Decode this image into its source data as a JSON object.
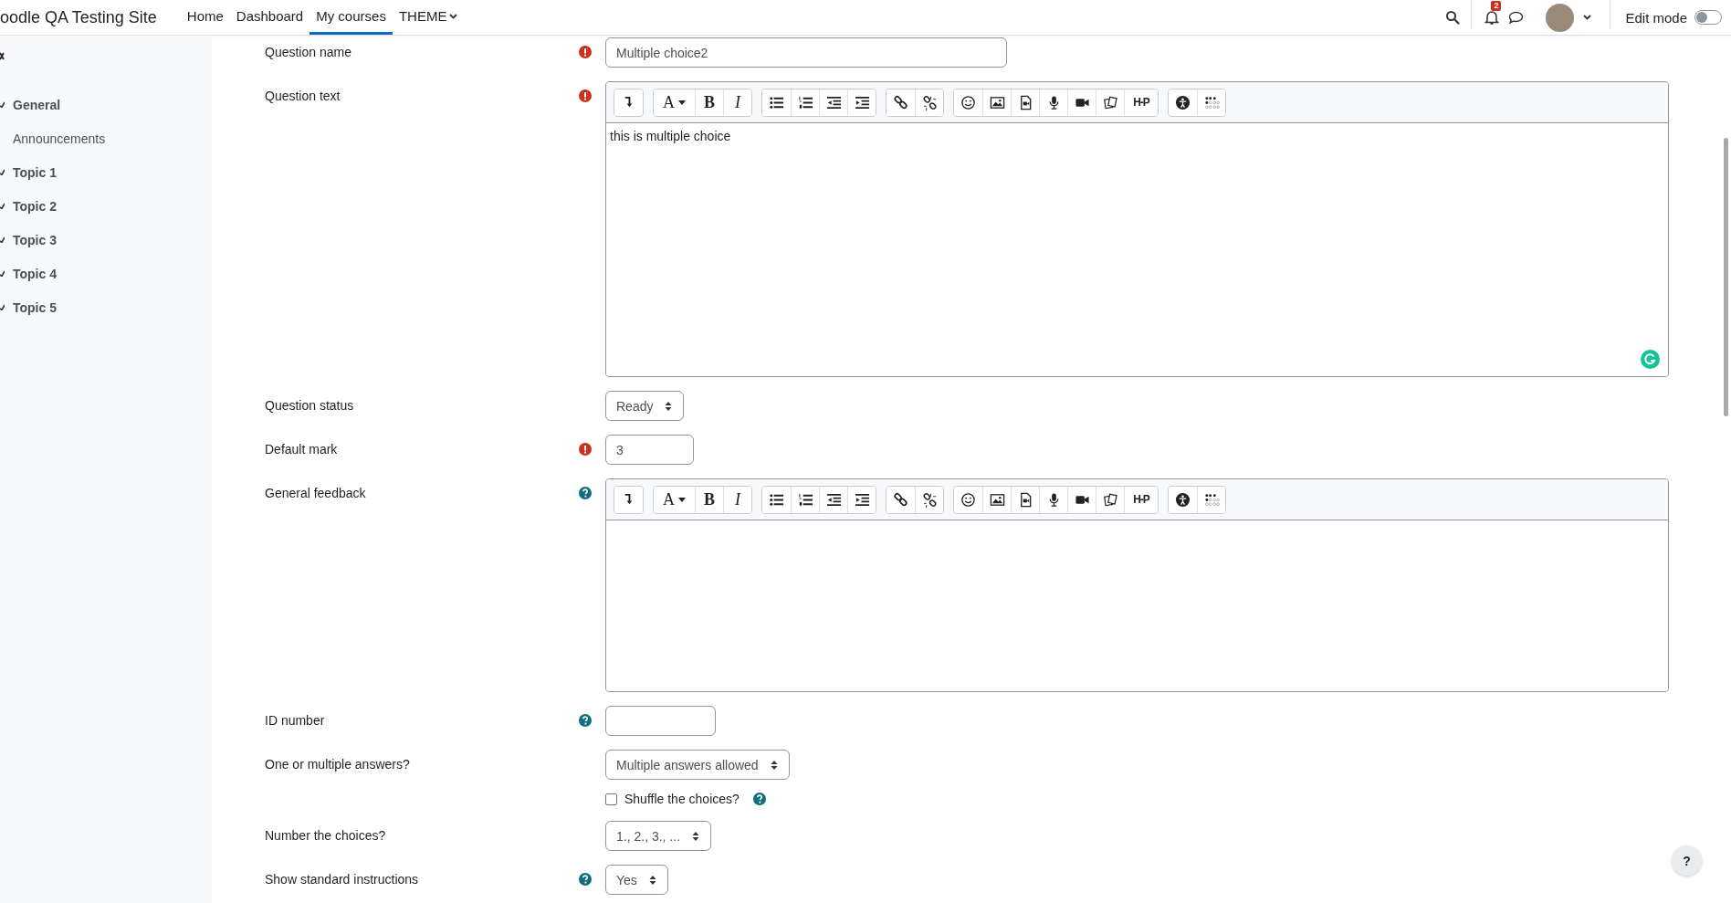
{
  "navbar": {
    "site_name": "oodle QA Testing Site",
    "links": [
      {
        "label": "Home",
        "selected": false,
        "dropdown": false
      },
      {
        "label": "Dashboard",
        "selected": false,
        "dropdown": false
      },
      {
        "label": "My courses",
        "selected": true,
        "dropdown": false
      },
      {
        "label": "THEME",
        "selected": false,
        "dropdown": true
      }
    ],
    "notification_count": "2",
    "edit_mode": {
      "label": "Edit mode",
      "on": false
    }
  },
  "course_index": {
    "items": [
      {
        "kind": "section",
        "label": "General",
        "expanded": true
      },
      {
        "kind": "activity",
        "label": "Announcements"
      },
      {
        "kind": "section",
        "label": "Topic 1",
        "expanded": true
      },
      {
        "kind": "section",
        "label": "Topic 2",
        "expanded": true
      },
      {
        "kind": "section",
        "label": "Topic 3",
        "expanded": true
      },
      {
        "kind": "section",
        "label": "Topic 4",
        "expanded": true
      },
      {
        "kind": "section",
        "label": "Topic 5",
        "expanded": true
      }
    ]
  },
  "form": {
    "rows": [
      {
        "kind": "text",
        "label": "Question name",
        "required": true,
        "help": false,
        "value": "Multiple choice2"
      },
      {
        "kind": "editor",
        "label": "Question text",
        "required": true,
        "help": false,
        "value": "this is multiple choice",
        "grammar_check": true,
        "toolbar": [
          [
            {
              "kind": "collapse"
            }
          ],
          [
            {
              "kind": "font",
              "label": "A"
            },
            {
              "kind": "bold",
              "label": "B"
            },
            {
              "kind": "italic",
              "label": "I"
            }
          ],
          [
            {
              "kind": "ul"
            },
            {
              "kind": "ol"
            },
            {
              "kind": "outdent"
            },
            {
              "kind": "indent"
            }
          ],
          [
            {
              "kind": "link"
            },
            {
              "kind": "unlink"
            }
          ],
          [
            {
              "kind": "emoji"
            },
            {
              "kind": "image"
            },
            {
              "kind": "media"
            },
            {
              "kind": "audio"
            },
            {
              "kind": "video"
            },
            {
              "kind": "files"
            },
            {
              "kind": "h5p",
              "label": "H-P"
            }
          ],
          [
            {
              "kind": "accessibility"
            },
            {
              "kind": "braille"
            }
          ]
        ]
      },
      {
        "kind": "select",
        "label": "Question status",
        "required": false,
        "help": false,
        "value": "Ready"
      },
      {
        "kind": "text",
        "label": "Default mark",
        "required": true,
        "help": false,
        "value": "3"
      },
      {
        "kind": "editor",
        "label": "General feedback",
        "required": false,
        "help": true,
        "grammar_check": false,
        "toolbar": [
          [
            {
              "kind": "collapse"
            }
          ],
          [
            {
              "kind": "font",
              "label": "A"
            },
            {
              "kind": "bold",
              "label": "B"
            },
            {
              "kind": "italic",
              "label": "I"
            }
          ],
          [
            {
              "kind": "ul"
            },
            {
              "kind": "ol"
            },
            {
              "kind": "outdent"
            },
            {
              "kind": "indent"
            }
          ],
          [
            {
              "kind": "link"
            },
            {
              "kind": "unlink"
            }
          ],
          [
            {
              "kind": "emoji"
            },
            {
              "kind": "image"
            },
            {
              "kind": "media"
            },
            {
              "kind": "audio"
            },
            {
              "kind": "video"
            },
            {
              "kind": "files"
            },
            {
              "kind": "h5p",
              "label": "H-P"
            }
          ],
          [
            {
              "kind": "accessibility"
            },
            {
              "kind": "braille"
            }
          ]
        ]
      },
      {
        "kind": "text",
        "label": "ID number",
        "required": false,
        "help": true
      },
      {
        "kind": "select",
        "label": "One or multiple answers?",
        "required": false,
        "help": false,
        "value": "Multiple answers allowed"
      },
      {
        "kind": "checkbox",
        "label": "Shuffle the choices?",
        "checked": false,
        "help": true
      },
      {
        "kind": "select",
        "label": "Number the choices?",
        "required": false,
        "help": false,
        "value": "1., 2., 3., ..."
      },
      {
        "kind": "select",
        "label": "Show standard instructions",
        "required": false,
        "help": true,
        "value": "Yes"
      }
    ]
  },
  "help_button": "?"
}
